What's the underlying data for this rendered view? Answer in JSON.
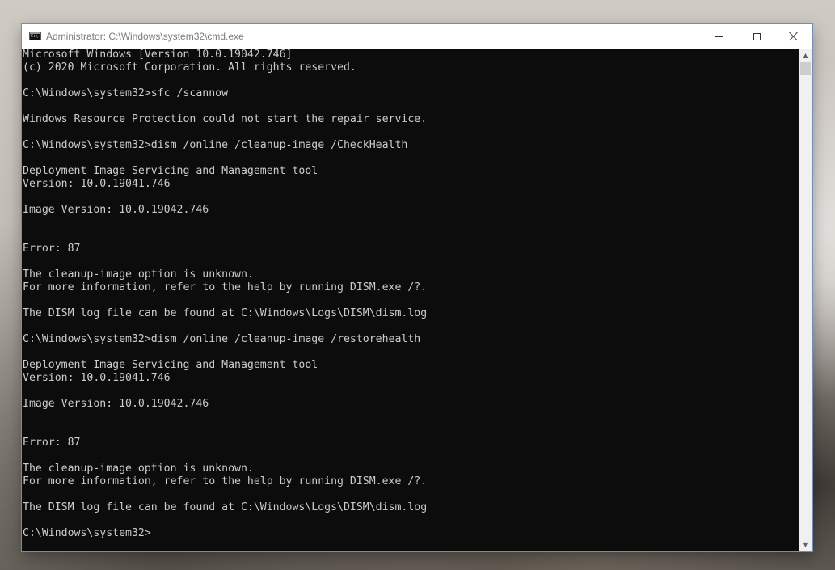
{
  "window": {
    "title": "Administrator: C:\\Windows\\system32\\cmd.exe",
    "icon": "cmd-icon"
  },
  "caption_buttons": {
    "minimize_icon": "minimize-icon",
    "maximize_icon": "maximize-icon",
    "close_icon": "close-icon"
  },
  "scrollbar": {
    "up_glyph": "▲",
    "down_glyph": "▼"
  },
  "console": {
    "lines": [
      "Microsoft Windows [Version 10.0.19042.746]",
      "(c) 2020 Microsoft Corporation. All rights reserved.",
      "",
      "C:\\Windows\\system32>sfc /scannow",
      "",
      "Windows Resource Protection could not start the repair service.",
      "",
      "C:\\Windows\\system32>dism /online /cleanup-image /CheckHealth",
      "",
      "Deployment Image Servicing and Management tool",
      "Version: 10.0.19041.746",
      "",
      "Image Version: 10.0.19042.746",
      "",
      "",
      "Error: 87",
      "",
      "The cleanup-image option is unknown.",
      "For more information, refer to the help by running DISM.exe /?.",
      "",
      "The DISM log file can be found at C:\\Windows\\Logs\\DISM\\dism.log",
      "",
      "C:\\Windows\\system32>dism /online /cleanup-image /restorehealth",
      "",
      "Deployment Image Servicing and Management tool",
      "Version: 10.0.19041.746",
      "",
      "Image Version: 10.0.19042.746",
      "",
      "",
      "Error: 87",
      "",
      "The cleanup-image option is unknown.",
      "For more information, refer to the help by running DISM.exe /?.",
      "",
      "The DISM log file can be found at C:\\Windows\\Logs\\DISM\\dism.log",
      "",
      "C:\\Windows\\system32>"
    ]
  },
  "colors": {
    "console_background": "#0c0c0c",
    "console_text": "#cccccc",
    "titlebar": "#ffffff",
    "title_text": "#7a7a7a"
  }
}
